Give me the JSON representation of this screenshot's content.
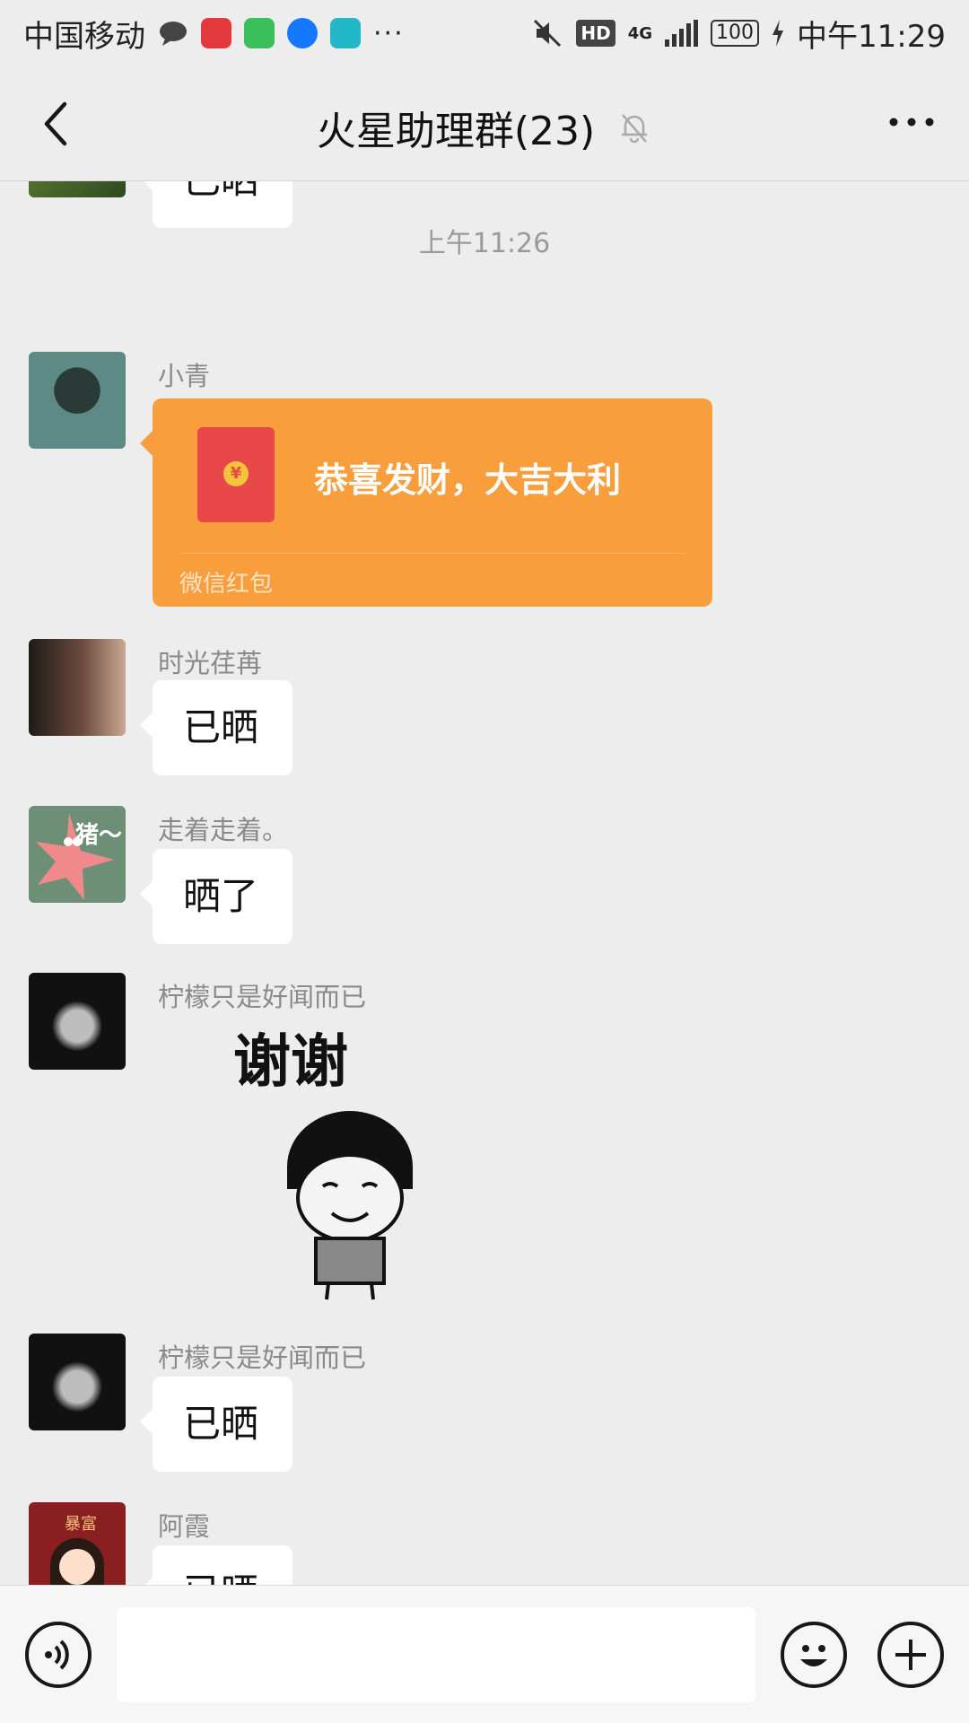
{
  "status_bar": {
    "carrier": "中国移动",
    "dots": "···",
    "hd": "HD",
    "network": "4G",
    "battery": "100",
    "time": "中午11:29"
  },
  "header": {
    "title": "火星助理群(23)"
  },
  "chat": {
    "partial_top_text": "已晒",
    "timestamp": "上午11:26",
    "messages": [
      {
        "sender": "小青",
        "type": "red_packet",
        "text": "恭喜发财，大吉大利",
        "label": "微信红包"
      },
      {
        "sender": "时光荏苒",
        "type": "text",
        "text": "已晒"
      },
      {
        "sender": "走着走着。",
        "type": "text",
        "text": "晒了"
      },
      {
        "sender": "柠檬只是好闻而已",
        "type": "sticker",
        "text": "谢谢"
      },
      {
        "sender": "柠檬只是好闻而已",
        "type": "text",
        "text": "已晒"
      },
      {
        "sender": "阿霞",
        "type": "text",
        "text": "已晒"
      }
    ],
    "avatar_texts": {
      "patrick": "猪～",
      "axia": "暴富"
    }
  },
  "colors": {
    "background": "#ededed",
    "red_packet": "#f99e3c",
    "envelope": "#e9484b"
  }
}
